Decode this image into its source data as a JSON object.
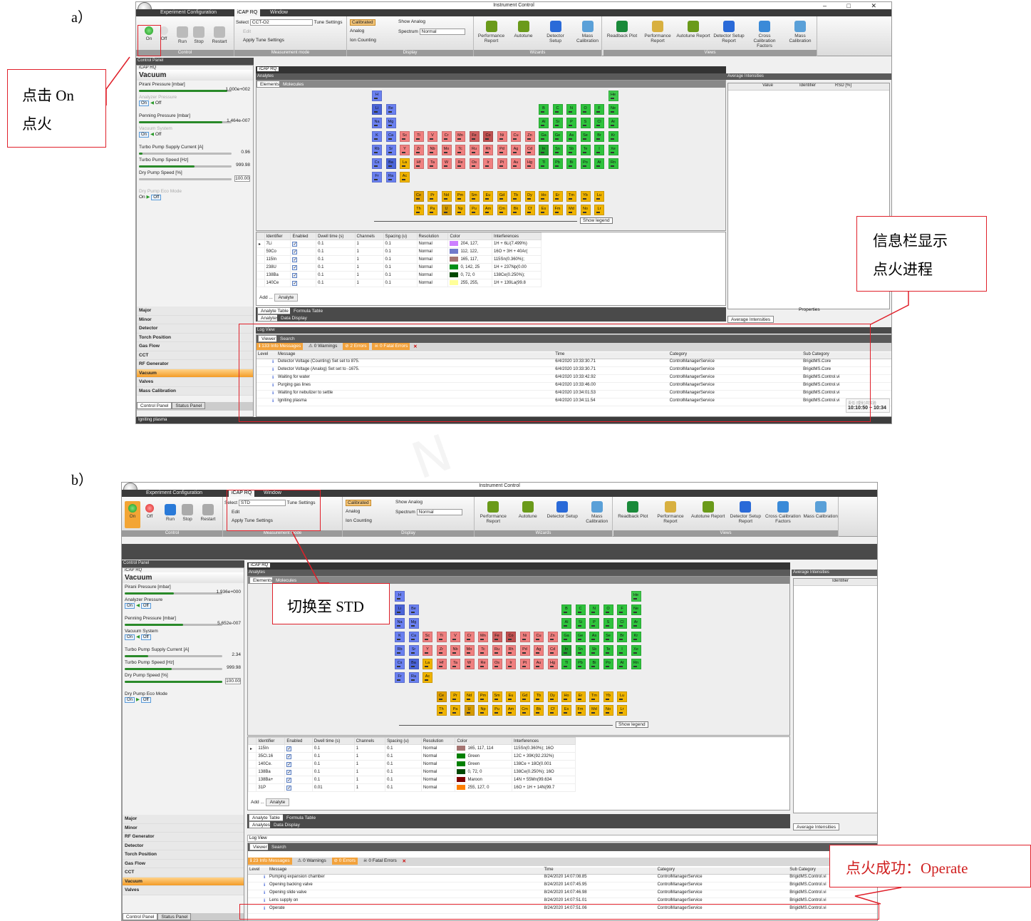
{
  "labels": {
    "a": "a）",
    "b": "b）"
  },
  "app": {
    "title": "Instrument Control",
    "win_controls": "–  □  ✕"
  },
  "tabs": [
    "Experiment Configuration",
    "iCAP RQ",
    "Window"
  ],
  "ribbon": {
    "control": {
      "on": "On",
      "off": "Off",
      "run": "Run",
      "stop": "Stop",
      "restart": "Restart",
      "group": "Control"
    },
    "measurement": {
      "select_label": "Select",
      "tune": "Tune Settings",
      "edit": "Edit",
      "apply": "Apply Tune Settings",
      "group": "Measurement mode"
    },
    "display": {
      "calibrated": "Calibrated",
      "analog": "Analog",
      "ion_counting": "Ion Counting",
      "show_analog": "Show Analog",
      "spectrum_label": "Spectrum",
      "spectrum_value": "Normal",
      "group": "Display"
    },
    "wizards": {
      "items": [
        "Performance Report",
        "Autotune",
        "Detector Setup",
        "Mass Calibration"
      ],
      "group": "Wizards"
    },
    "views": {
      "items": [
        "Readback Plot",
        "Performance Report",
        "Autotune Report",
        "Detector Setup Report",
        "Cross Calibration Factors",
        "Mass Calibration"
      ],
      "group": "Views"
    }
  },
  "left_panel": {
    "header": "Control Panel",
    "sub": "iCAP RQ",
    "title": "Vacuum",
    "pirani": "Pirani Pressure [mbar]",
    "analyzer": "Analyzer Pressure",
    "penning": "Penning Pressure [mbar]",
    "vacuum_system": "Vacuum System",
    "turbo_current": "Turbo Pump Supply Current [A]",
    "turbo_speed": "Turbo Pump Speed [Hz]",
    "dry_speed": "Dry Pump Speed [%]",
    "dry_eco": "Dry Pump Eco Mode",
    "on": "On",
    "off": "Off",
    "tab_control": "Control Panel",
    "tab_status": "Status Panel"
  },
  "a_left": {
    "pirani_val": "1.000e+002",
    "penning_val": "1.464e-007",
    "turbo_current_val": "0.96",
    "turbo_speed_val": "999.98",
    "dry_speed_val": "100.00",
    "status": "Igniting plasma",
    "nav": [
      "Major",
      "Minor",
      "Detector",
      "Torch Position",
      "Gas Flow",
      "CCT",
      "RF Generator",
      "Vacuum",
      "Valves",
      "Mass Calibration"
    ]
  },
  "b_left": {
    "pirani_val": "1.936e+000",
    "penning_val": "5.652e-007",
    "turbo_current_val": "2.34",
    "turbo_speed_val": "999.98",
    "dry_speed_val": "100.00",
    "nav": [
      "Major",
      "Minor",
      "RF Generator",
      "Detector",
      "Torch Position",
      "Gas Flow",
      "CCT",
      "Vacuum",
      "Valves"
    ]
  },
  "center": {
    "tab": "iCAP RQ",
    "analytes": "Analytes",
    "elements_tab": "Elements",
    "molecules_tab": "Molecules",
    "show_legend": "Show legend",
    "add": "Add ...",
    "analyte_btn": "Analyte",
    "analyte_table_tab": "Analyte Table",
    "formula_table_tab": "Formula Table",
    "analytes_tab": "Analytes",
    "data_display_tab": "Data Display"
  },
  "table_headers": [
    "Identifier",
    "Enabled",
    "Dwell time (s)",
    "Channels",
    "Spacing (u)",
    "Resolution",
    "Color",
    "Interferences"
  ],
  "a_table": [
    {
      "id": "7Li",
      "dwell": "0.1",
      "ch": "1",
      "sp": "0.1",
      "res": "Normal",
      "color": "204, 127,",
      "sw": "#cc7fff",
      "inter": "1H + 6Li(7.499%)"
    },
    {
      "id": "59Co",
      "dwell": "0.1",
      "ch": "1",
      "sp": "0.1",
      "res": "Normal",
      "color": "112, 122,",
      "sw": "#707acc",
      "inter": "16O + 3H + 40Ar("
    },
    {
      "id": "115In",
      "dwell": "0.1",
      "ch": "1",
      "sp": "0.1",
      "res": "Normal",
      "color": "165, 117,",
      "sw": "#a57572",
      "inter": "115Sn(0.360%);"
    },
    {
      "id": "238U",
      "dwell": "0.1",
      "ch": "1",
      "sp": "0.1",
      "res": "Normal",
      "color": "0, 142, 25",
      "sw": "#008e19",
      "inter": "1H + 237Np(0.00"
    },
    {
      "id": "138Ba",
      "dwell": "0.1",
      "ch": "1",
      "sp": "0.1",
      "res": "Normal",
      "color": "0, 72, 0",
      "sw": "#004800",
      "inter": "138Ce(0.250%);"
    },
    {
      "id": "140Ce",
      "dwell": "0.1",
      "ch": "1",
      "sp": "0.1",
      "res": "Normal",
      "color": "255, 255,",
      "sw": "#ffff99",
      "inter": "1H + 139La(99.8"
    }
  ],
  "b_table": [
    {
      "id": "115In",
      "dwell": "0.1",
      "ch": "1",
      "sp": "0.1",
      "res": "Normal",
      "color": "165, 117, 114",
      "sw": "#a57572",
      "inter": "115Sn(0.360%); 16O"
    },
    {
      "id": "35Cl.16",
      "dwell": "0.1",
      "ch": "1",
      "sp": "0.1",
      "res": "Normal",
      "color": "Green",
      "sw": "#008000",
      "inter": "12C + 39K(92.232%)"
    },
    {
      "id": "140Ce.",
      "dwell": "0.1",
      "ch": "1",
      "sp": "0.1",
      "res": "Normal",
      "color": "Green",
      "sw": "#008000",
      "inter": "138Ce + 18O(0.001"
    },
    {
      "id": "138Ba",
      "dwell": "0.1",
      "ch": "1",
      "sp": "0.1",
      "res": "Normal",
      "color": "0, 72, 0",
      "sw": "#004800",
      "inter": "138Ce(0.250%); 16O"
    },
    {
      "id": "138Ba+",
      "dwell": "0.1",
      "ch": "1",
      "sp": "0.1",
      "res": "Normal",
      "color": "Maroon",
      "sw": "#800000",
      "inter": "14N + 55Mn(99.634"
    },
    {
      "id": "31P",
      "dwell": "0.01",
      "ch": "1",
      "sp": "0.1",
      "res": "Normal",
      "color": "255, 127, 0",
      "sw": "#ff7f00",
      "inter": "16O + 1H + 14N(99.7"
    }
  ],
  "right": {
    "title": "Average Intensities",
    "value": "Value",
    "identifier": "Identifier",
    "rsd": "RSD [%]",
    "properties": "Properties",
    "tab": "Average Intensities"
  },
  "log": {
    "title": "Log View",
    "viewer": "Viewer",
    "search": "Search",
    "level": "Level",
    "message": "Message",
    "time": "Time",
    "category": "Category",
    "subcategory": "Sub Category",
    "warnings": "0 Warnings",
    "fatal": "0 Fatal Errors"
  },
  "a_log": {
    "info": "133 Info Messages",
    "errors": "2 Errors",
    "rows": [
      {
        "m": "Detector Voltage (Counting) Set set to 875.",
        "t": "6/4/2020 10:33:30.71",
        "c": "ControlManagerService",
        "s": "BrigidMS.Core"
      },
      {
        "m": "Detector Voltage (Analog) Set set to -1675.",
        "t": "6/4/2020 10:33:30.71",
        "c": "ControlManagerService",
        "s": "BrigidMS.Core"
      },
      {
        "m": "Waiting for water",
        "t": "6/4/2020 10:33:42.92",
        "c": "ControlManagerService",
        "s": "BrigidMS.Control.vi"
      },
      {
        "m": "Purging gas lines",
        "t": "6/4/2020 10:33:46.00",
        "c": "ControlManagerService",
        "s": "BrigidMS.Control.vi"
      },
      {
        "m": "Waiting for nebulizer to settle",
        "t": "6/4/2020 10:34:01.53",
        "c": "ControlManagerService",
        "s": "BrigidMS.Control.vi"
      },
      {
        "m": "Igniting plasma",
        "t": "6/4/2020 10:34:11.54",
        "c": "ControlManagerService",
        "s": "BrigidMS.Control.vi"
      }
    ],
    "clock": "10:10:50 ~ 10:34",
    "tip": "责任 (理化)共实验"
  },
  "b_log": {
    "info": "23 Info Messages",
    "errors": "0 Errors",
    "rows": [
      {
        "m": "Pumping expansion chamber",
        "t": "8/24/2020 14:07:08.85",
        "c": "ControlManagerService",
        "s": "BrigidMS.Control.vi"
      },
      {
        "m": "Opening backing valve",
        "t": "8/24/2020 14:07:45.95",
        "c": "ControlManagerService",
        "s": "BrigidMS.Control.vi"
      },
      {
        "m": "Opening slide valve",
        "t": "8/24/2020 14:07:46.98",
        "c": "ControlManagerService",
        "s": "BrigidMS.Control.vi"
      },
      {
        "m": "Lens supply on",
        "t": "8/24/2020 14:07:51.01",
        "c": "ControlManagerService",
        "s": "BrigidMS.Control.vi"
      },
      {
        "m": "Operate",
        "t": "8/24/2020 14:07:51.06",
        "c": "ControlManagerService",
        "s": "BrigidMS.Control.vi"
      }
    ]
  },
  "a_select": "CCT-O2",
  "b_select": "STD",
  "callouts": {
    "a1_line1": "点击 On",
    "a1_line2": "点火",
    "a2_line1": "信息栏显示",
    "a2_line2": "点火进程",
    "b1": "切换至 STD",
    "b2": "点火成功：Operate"
  },
  "elements": [
    [
      "H",
      0,
      0,
      "#6a80f0"
    ],
    [
      "He",
      17,
      0,
      "#3ec84a"
    ],
    [
      "Li",
      0,
      1,
      "#4a64d8"
    ],
    [
      "Be",
      1,
      1,
      "#6a80f0"
    ],
    [
      "B",
      12,
      1,
      "#2fc33d"
    ],
    [
      "C",
      13,
      1,
      "#2fc33d"
    ],
    [
      "N",
      14,
      1,
      "#2fc33d"
    ],
    [
      "O",
      15,
      1,
      "#2fc33d"
    ],
    [
      "F",
      16,
      1,
      "#2fc33d"
    ],
    [
      "Ne",
      17,
      1,
      "#2fc33d"
    ],
    [
      "Na",
      0,
      2,
      "#6a80f0"
    ],
    [
      "Mg",
      1,
      2,
      "#6a80f0"
    ],
    [
      "Al",
      12,
      2,
      "#2fc33d"
    ],
    [
      "Si",
      13,
      2,
      "#2fc33d"
    ],
    [
      "P",
      14,
      2,
      "#2fc33d"
    ],
    [
      "S",
      15,
      2,
      "#2fc33d"
    ],
    [
      "Cl",
      16,
      2,
      "#2fc33d"
    ],
    [
      "Ar",
      17,
      2,
      "#2fc33d"
    ],
    [
      "K",
      0,
      3,
      "#6a80f0"
    ],
    [
      "Ca",
      1,
      3,
      "#6a80f0"
    ],
    [
      "Sc",
      2,
      3,
      "#f08080"
    ],
    [
      "Ti",
      3,
      3,
      "#f08080"
    ],
    [
      "V",
      4,
      3,
      "#f08080"
    ],
    [
      "Cr",
      5,
      3,
      "#f08080"
    ],
    [
      "Mn",
      6,
      3,
      "#f08080"
    ],
    [
      "Fe",
      7,
      3,
      "#d06060"
    ],
    [
      "Co",
      8,
      3,
      "#c05050"
    ],
    [
      "Ni",
      9,
      3,
      "#f08080"
    ],
    [
      "Cu",
      10,
      3,
      "#f08080"
    ],
    [
      "Zn",
      11,
      3,
      "#f08080"
    ],
    [
      "Ga",
      12,
      3,
      "#2fc33d"
    ],
    [
      "Ge",
      13,
      3,
      "#2fc33d"
    ],
    [
      "As",
      14,
      3,
      "#2fc33d"
    ],
    [
      "Se",
      15,
      3,
      "#2fc33d"
    ],
    [
      "Br",
      16,
      3,
      "#2fc33d"
    ],
    [
      "Kr",
      17,
      3,
      "#2fc33d"
    ],
    [
      "Rb",
      0,
      4,
      "#6a80f0"
    ],
    [
      "Sr",
      1,
      4,
      "#6a80f0"
    ],
    [
      "Y",
      2,
      4,
      "#f08080"
    ],
    [
      "Zr",
      3,
      4,
      "#f08080"
    ],
    [
      "Nb",
      4,
      4,
      "#f08080"
    ],
    [
      "Mo",
      5,
      4,
      "#f08080"
    ],
    [
      "Tc",
      6,
      4,
      "#f08080"
    ],
    [
      "Ru",
      7,
      4,
      "#f08080"
    ],
    [
      "Rh",
      8,
      4,
      "#f08080"
    ],
    [
      "Pd",
      9,
      4,
      "#f08080"
    ],
    [
      "Ag",
      10,
      4,
      "#f08080"
    ],
    [
      "Cd",
      11,
      4,
      "#f08080"
    ],
    [
      "In",
      12,
      4,
      "#1fa02d"
    ],
    [
      "Sn",
      13,
      4,
      "#2fc33d"
    ],
    [
      "Sb",
      14,
      4,
      "#2fc33d"
    ],
    [
      "Te",
      15,
      4,
      "#2fc33d"
    ],
    [
      "I",
      16,
      4,
      "#2fc33d"
    ],
    [
      "Xe",
      17,
      4,
      "#2fc33d"
    ],
    [
      "Cs",
      0,
      5,
      "#6a80f0"
    ],
    [
      "Ba",
      1,
      5,
      "#4a64d8"
    ],
    [
      "La",
      2,
      5,
      "#f0b400"
    ],
    [
      "Hf",
      3,
      5,
      "#f08080"
    ],
    [
      "Ta",
      4,
      5,
      "#f08080"
    ],
    [
      "W",
      5,
      5,
      "#f08080"
    ],
    [
      "Re",
      6,
      5,
      "#f08080"
    ],
    [
      "Os",
      7,
      5,
      "#f08080"
    ],
    [
      "Ir",
      8,
      5,
      "#f08080"
    ],
    [
      "Pt",
      9,
      5,
      "#f08080"
    ],
    [
      "Au",
      10,
      5,
      "#f08080"
    ],
    [
      "Hg",
      11,
      5,
      "#f08080"
    ],
    [
      "Tl",
      12,
      5,
      "#2fc33d"
    ],
    [
      "Pb",
      13,
      5,
      "#2fc33d"
    ],
    [
      "Bi",
      14,
      5,
      "#2fc33d"
    ],
    [
      "Po",
      15,
      5,
      "#2fc33d"
    ],
    [
      "At",
      16,
      5,
      "#2fc33d"
    ],
    [
      "Rn",
      17,
      5,
      "#2fc33d"
    ],
    [
      "Fr",
      0,
      6,
      "#6a80f0"
    ],
    [
      "Ra",
      1,
      6,
      "#6a80f0"
    ],
    [
      "Ac",
      2,
      6,
      "#f0b400"
    ],
    [
      "Ce",
      3,
      7.4,
      "#e0a000"
    ],
    [
      "Pr",
      4,
      7.4,
      "#f0b400"
    ],
    [
      "Nd",
      5,
      7.4,
      "#f0b400"
    ],
    [
      "Pm",
      6,
      7.4,
      "#f0b400"
    ],
    [
      "Sm",
      7,
      7.4,
      "#f0b400"
    ],
    [
      "Eu",
      8,
      7.4,
      "#f0b400"
    ],
    [
      "Gd",
      9,
      7.4,
      "#f0b400"
    ],
    [
      "Tb",
      10,
      7.4,
      "#f0b400"
    ],
    [
      "Dy",
      11,
      7.4,
      "#f0b400"
    ],
    [
      "Ho",
      12,
      7.4,
      "#f0b400"
    ],
    [
      "Er",
      13,
      7.4,
      "#f0b400"
    ],
    [
      "Tm",
      14,
      7.4,
      "#f0b400"
    ],
    [
      "Yb",
      15,
      7.4,
      "#f0b400"
    ],
    [
      "Lu",
      16,
      7.4,
      "#f0b400"
    ],
    [
      "Th",
      3,
      8.4,
      "#f0b400"
    ],
    [
      "Pa",
      4,
      8.4,
      "#f0b400"
    ],
    [
      "U",
      5,
      8.4,
      "#d49a00"
    ],
    [
      "Np",
      6,
      8.4,
      "#f0b400"
    ],
    [
      "Pu",
      7,
      8.4,
      "#f0b400"
    ],
    [
      "Am",
      8,
      8.4,
      "#f0b400"
    ],
    [
      "Cm",
      9,
      8.4,
      "#f0b400"
    ],
    [
      "Bk",
      10,
      8.4,
      "#f0b400"
    ],
    [
      "Cf",
      11,
      8.4,
      "#f0b400"
    ],
    [
      "Es",
      12,
      8.4,
      "#f0b400"
    ],
    [
      "Fm",
      13,
      8.4,
      "#f0b400"
    ],
    [
      "Md",
      14,
      8.4,
      "#f0b400"
    ],
    [
      "No",
      15,
      8.4,
      "#f0b400"
    ],
    [
      "Lr",
      16,
      8.4,
      "#f0b400"
    ]
  ],
  "watermark": "N"
}
